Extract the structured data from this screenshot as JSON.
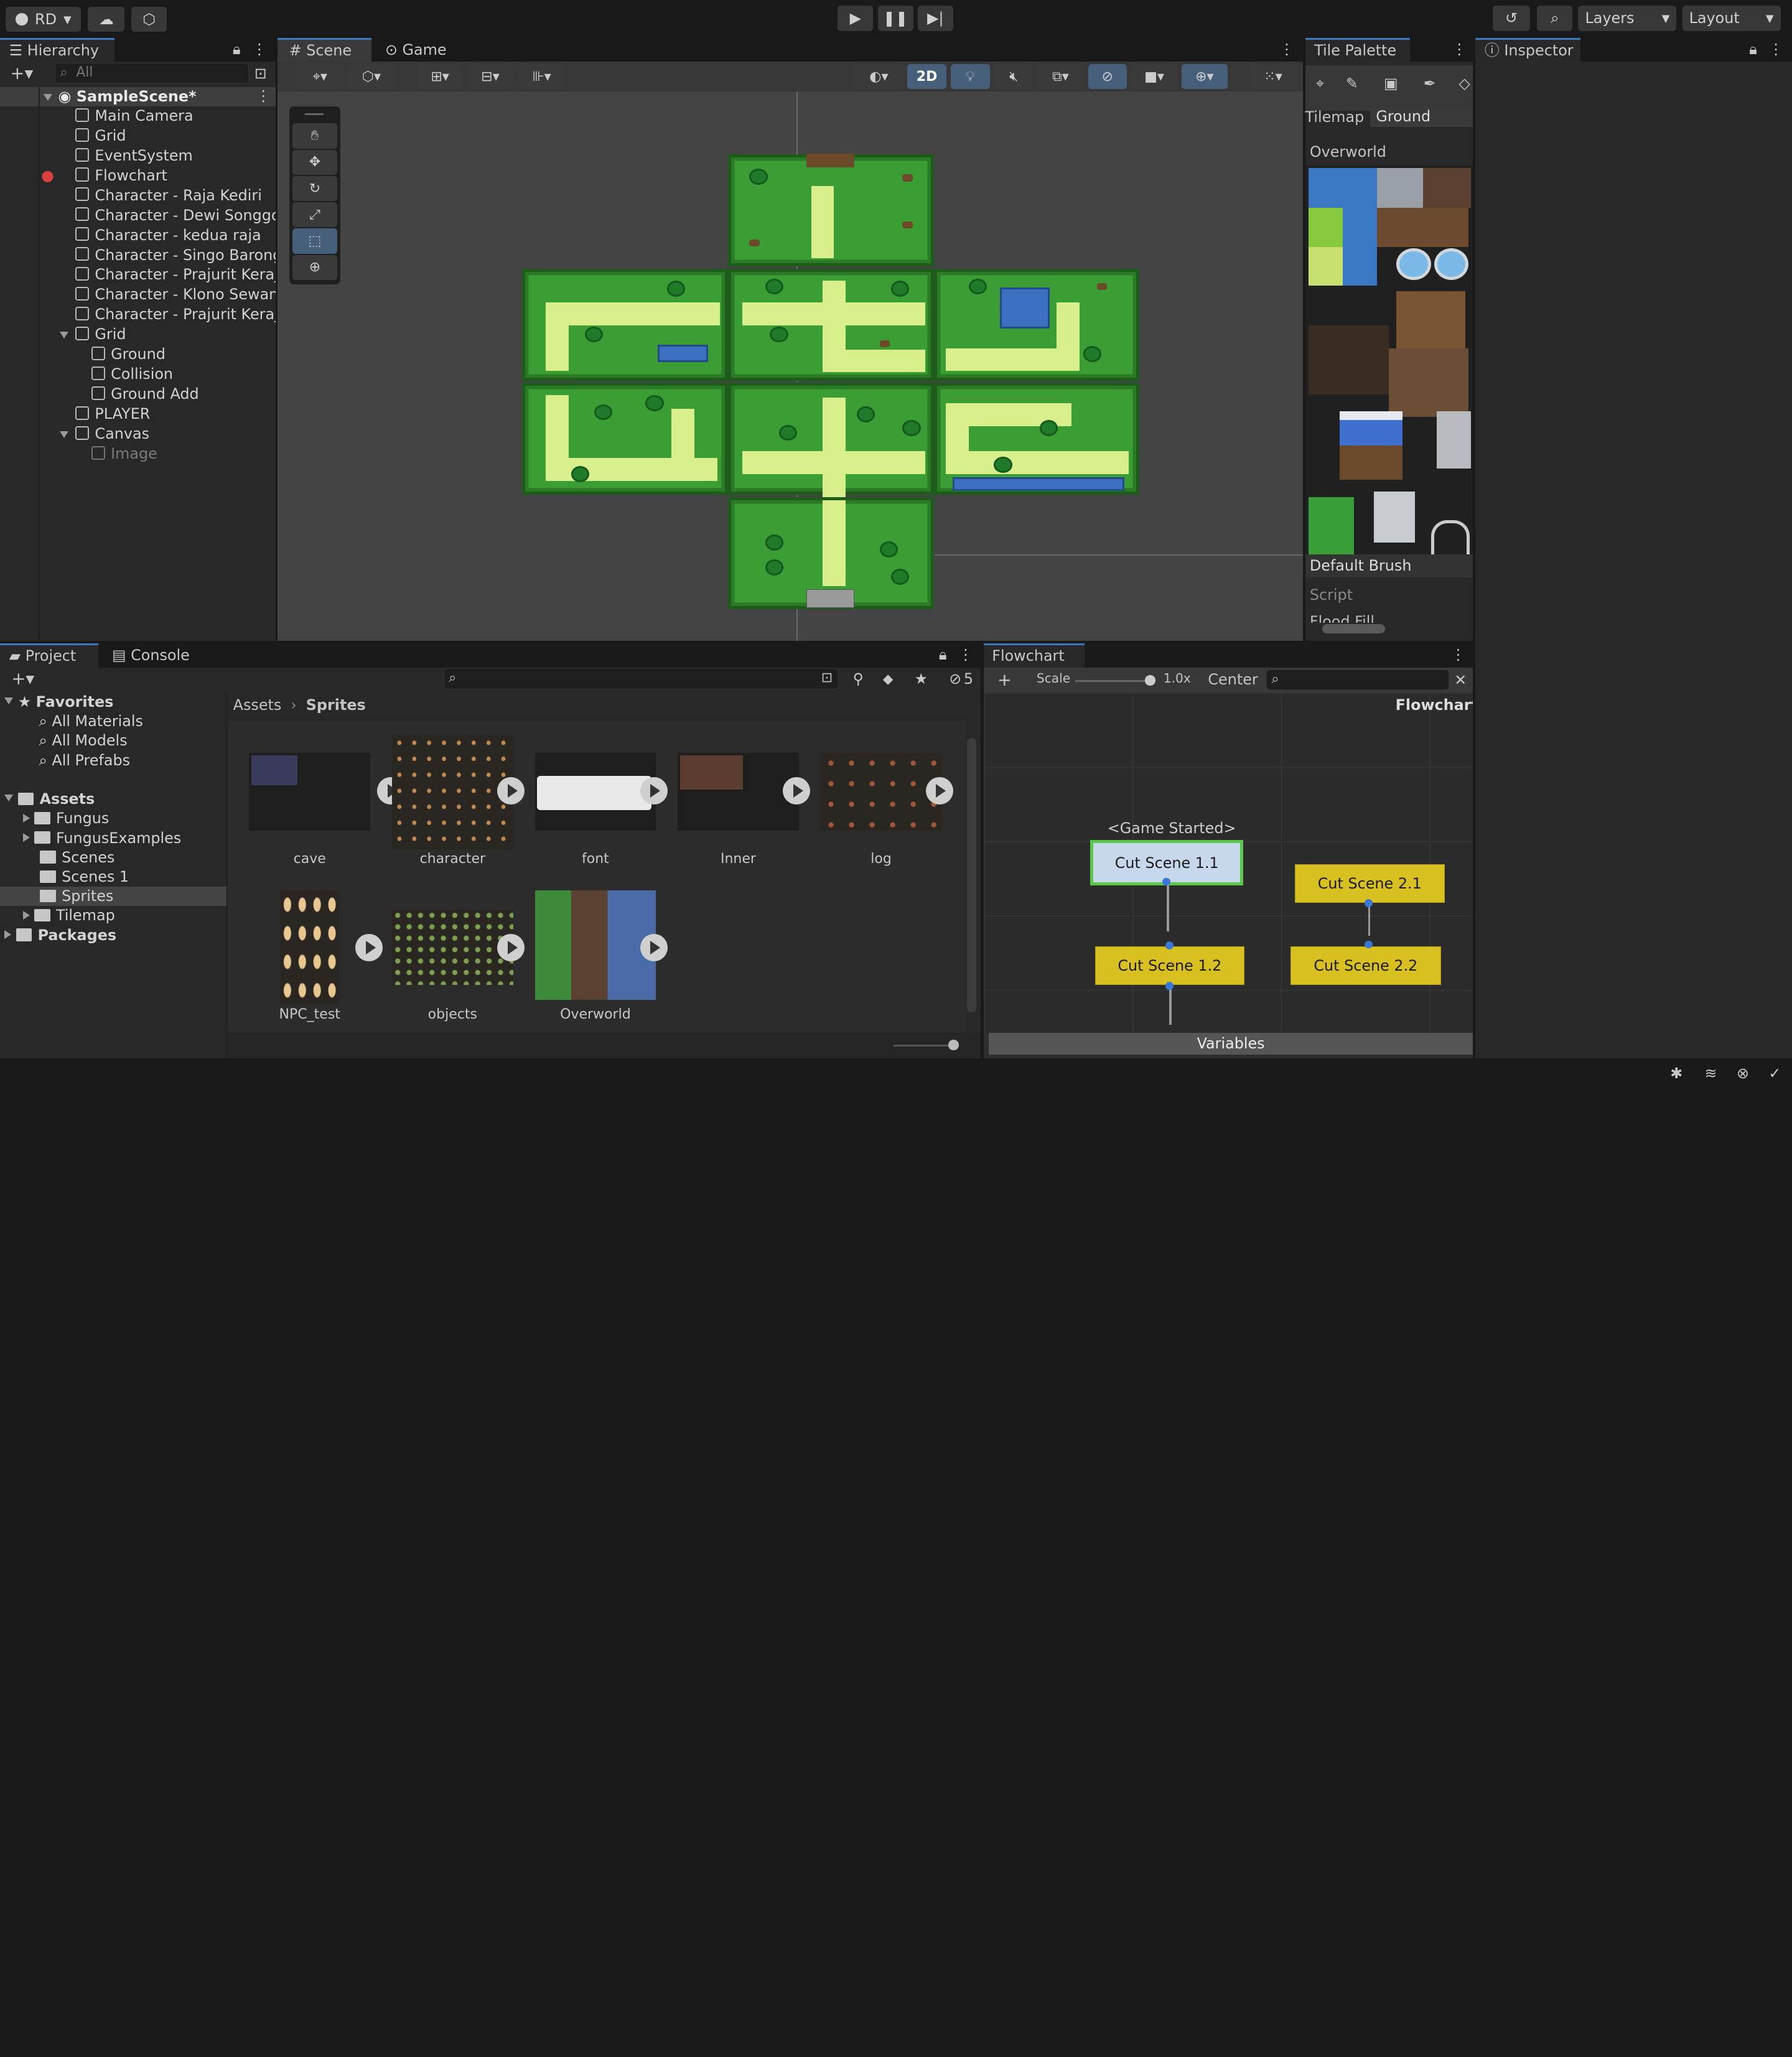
{
  "toolbar": {
    "account": "RD",
    "layers": "Layers",
    "layout": "Layout"
  },
  "hierarchy": {
    "tab": "Hierarchy",
    "search_placeholder": "All",
    "scene": "SampleScene*",
    "items": [
      {
        "label": "Main Camera",
        "indent": 1
      },
      {
        "label": "Grid",
        "indent": 1
      },
      {
        "label": "EventSystem",
        "indent": 1
      },
      {
        "label": "Flowchart",
        "indent": 1
      },
      {
        "label": "Character - Raja Kediri",
        "indent": 1
      },
      {
        "label": "Character - Dewi Songgo",
        "indent": 1
      },
      {
        "label": "Character - kedua raja",
        "indent": 1
      },
      {
        "label": "Character - Singo Barong",
        "indent": 1
      },
      {
        "label": "Character - Prajurit Keraja",
        "indent": 1
      },
      {
        "label": "Character - Klono Sewan",
        "indent": 1
      },
      {
        "label": "Character - Prajurit Keraja",
        "indent": 1
      },
      {
        "label": "Grid",
        "indent": 1
      },
      {
        "label": "Ground",
        "indent": 2
      },
      {
        "label": "Collision",
        "indent": 2
      },
      {
        "label": "Ground Add",
        "indent": 2
      },
      {
        "label": "PLAYER",
        "indent": 1
      },
      {
        "label": "Canvas",
        "indent": 1
      },
      {
        "label": "Image",
        "indent": 2
      }
    ]
  },
  "scene": {
    "tabs": [
      "Scene",
      "Game"
    ],
    "mode_2d": "2D"
  },
  "tile_palette": {
    "tab": "Tile Palette",
    "tilemap_label": "Tilemap",
    "tilemap_value": "Ground",
    "palette": "Overworld",
    "brush": "Default Brush",
    "script_label": "Script",
    "flood_fill": "Flood Fill Contiguous"
  },
  "inspector": {
    "tab": "Inspector"
  },
  "project": {
    "tabs": [
      "Project",
      "Console"
    ],
    "hidden_count": "5",
    "favorites": "Favorites",
    "fav_items": [
      "All Materials",
      "All Models",
      "All Prefabs"
    ],
    "assets": "Assets",
    "folders": [
      "Fungus",
      "FungusExamples",
      "Scenes",
      "Scenes 1",
      "Sprites",
      "Tilemap"
    ],
    "packages": "Packages",
    "breadcrumb": [
      "Assets",
      "Sprites"
    ],
    "files": [
      "cave",
      "character",
      "font",
      "Inner",
      "log",
      "NPC_test",
      "objects",
      "Overworld"
    ]
  },
  "flowchart": {
    "tab": "Flowchart",
    "scale_label": "Scale",
    "scale_value": "1.0x",
    "center": "Center",
    "title": "Flowchart",
    "event": "<Game Started>",
    "nodes": [
      "Cut Scene 1.1",
      "Cut Scene 1.2",
      "Cut Scene 2.1",
      "Cut Scene 2.2"
    ],
    "variables": "Variables"
  },
  "colors": {
    "accent": "#3a79bb",
    "node": "#d9c021",
    "selected_node": "#c8d8ec"
  }
}
